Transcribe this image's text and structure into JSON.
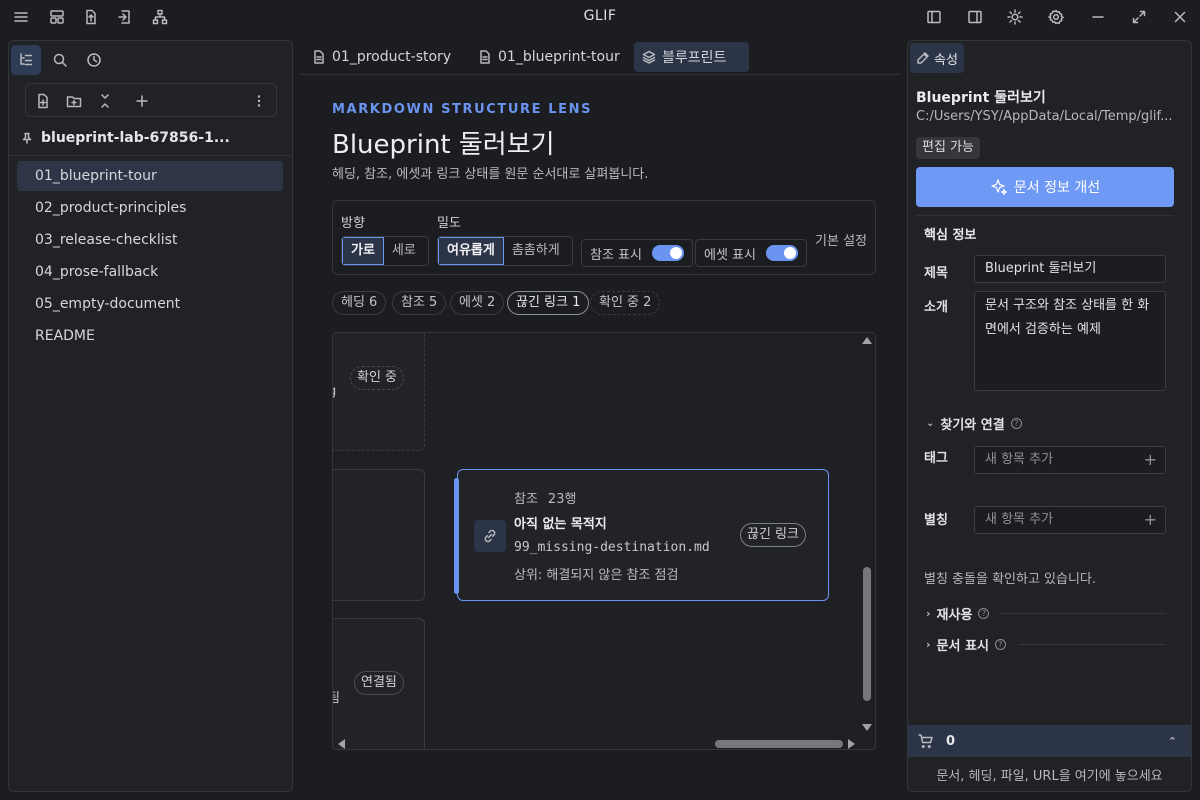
{
  "app": {
    "title": "GLIF"
  },
  "sidebar": {
    "vault_name": "blueprint-lab-67856-1...",
    "files": [
      {
        "label": "01_blueprint-tour",
        "active": true
      },
      {
        "label": "02_product-principles"
      },
      {
        "label": "03_release-checklist"
      },
      {
        "label": "04_prose-fallback"
      },
      {
        "label": "05_empty-document"
      },
      {
        "label": "README"
      }
    ]
  },
  "tabs": [
    {
      "label": "01_product-story",
      "icon": "document-icon"
    },
    {
      "label": "01_blueprint-tour",
      "icon": "document-icon"
    },
    {
      "label": "블루프린트",
      "icon": "layers-icon",
      "active": true
    }
  ],
  "main": {
    "lens_label": "MARKDOWN STRUCTURE LENS",
    "title": "Blueprint 둘러보기",
    "description": "헤딩, 참조, 에셋과 링크 상태를 원문 순서대로 살펴봅니다.",
    "direction_label": "방향",
    "direction_options": [
      "가로",
      "세로"
    ],
    "density_label": "밀도",
    "density_options": [
      "여유롭게",
      "촘촘하게"
    ],
    "show_refs_label": "참조 표시",
    "show_assets_label": "에셋 표시",
    "basic_setting": "기본 설정",
    "chips": [
      "헤딩 6",
      "참조 5",
      "에셋 2",
      "끊긴 링크 1",
      "확인 중 2"
    ]
  },
  "canvas": {
    "pill_checking": "확인 중",
    "pill_connected": "연결됨",
    "partial_text_1": "g",
    "partial_text_2": "됨",
    "ref_card": {
      "kind": "참조",
      "line": "23행",
      "title": "아직 없는 목적지",
      "path": "99_missing-destination.md",
      "parent": "상위: 해결되지 않은 참조 점검",
      "badge": "끊긴 링크"
    }
  },
  "properties": {
    "tab_label": "속성",
    "title": "Blueprint 둘러보기",
    "path": "C:/Users/YSY/AppData/Local/Temp/glif...",
    "badge": "편집 가능",
    "improve_button": "문서 정보 개선",
    "core_heading": "핵심 정보",
    "title_label": "제목",
    "title_value": "Blueprint 둘러보기",
    "intro_label": "소개",
    "intro_value": "문서 구조와 참조 상태를 한 화면에서 검증하는 예제",
    "find_section": "찾기와 연결",
    "tags_label": "태그",
    "tags_placeholder": "새 항목 추가",
    "alias_label": "별칭",
    "alias_placeholder": "새 항목 추가",
    "alias_status": "별칭 충돌을 확인하고 있습니다.",
    "reuse_section": "재사용",
    "display_section": "문서 표시",
    "cart_count": "0",
    "drop_hint": "문서, 헤딩, 파일, URL을 여기에 놓으세요"
  },
  "colors": {
    "accent": "#6b94f0",
    "button": "#6e9af5",
    "active_bg": "#2c3447"
  }
}
